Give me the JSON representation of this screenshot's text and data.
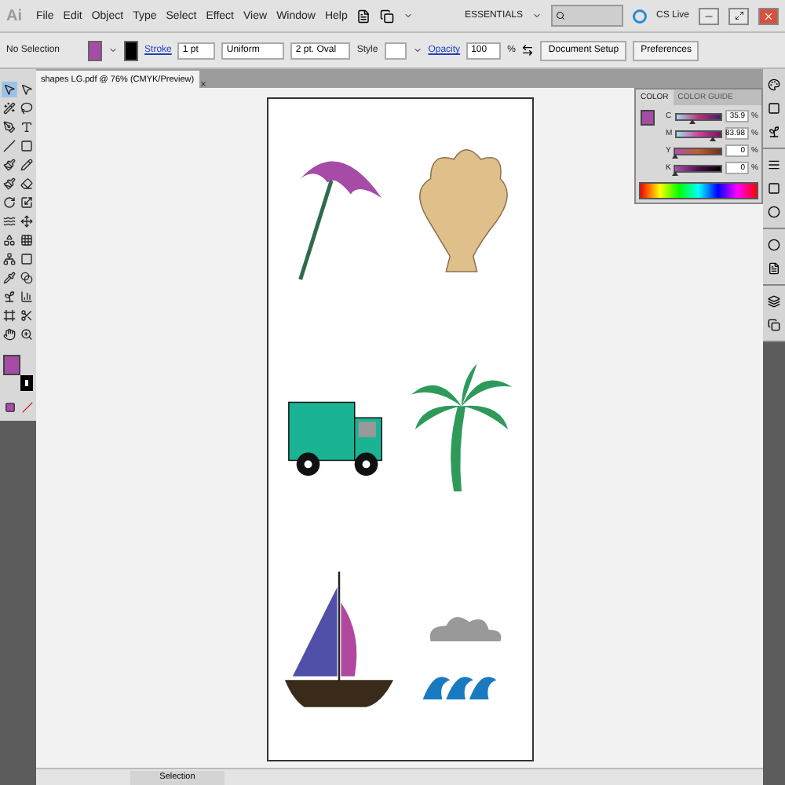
{
  "app": {
    "logo": "Ai",
    "menu": [
      "File",
      "Edit",
      "Object",
      "Type",
      "Select",
      "Effect",
      "View",
      "Window",
      "Help"
    ],
    "workspace": "ESSENTIALS",
    "cs_live": "CS Live"
  },
  "control_bar": {
    "selection": "No Selection",
    "stroke_label": "Stroke",
    "stroke_weight": "1 pt",
    "profile": "Uniform",
    "brush": "2 pt. Oval",
    "style_label": "Style",
    "opacity_label": "Opacity",
    "opacity": "100",
    "percent": "%",
    "buttons": [
      "Document Setup",
      "Preferences"
    ]
  },
  "document": {
    "tab": "shapes LG.pdf @ 76% (CMYK/Preview)",
    "artwork": [
      {
        "kind": "umbrella"
      },
      {
        "kind": "shell"
      },
      {
        "kind": "truck"
      },
      {
        "kind": "palm"
      },
      {
        "kind": "sailboat"
      },
      {
        "kind": "cloud-waves"
      }
    ]
  },
  "tools": [
    {
      "kind": "select",
      "selected": true
    },
    {
      "kind": "direct",
      "selected": false
    },
    {
      "kind": "wand",
      "selected": false
    },
    {
      "kind": "lasso",
      "selected": false
    },
    {
      "kind": "pen",
      "selected": false
    },
    {
      "kind": "type",
      "selected": false
    },
    {
      "kind": "line",
      "selected": false
    },
    {
      "kind": "rect",
      "selected": false
    },
    {
      "kind": "brush",
      "selected": false
    },
    {
      "kind": "pencil",
      "selected": false
    },
    {
      "kind": "blob",
      "selected": false
    },
    {
      "kind": "eraser",
      "selected": false
    },
    {
      "kind": "rotate",
      "selected": false
    },
    {
      "kind": "scale",
      "selected": false
    },
    {
      "kind": "warp",
      "selected": false
    },
    {
      "kind": "transform",
      "selected": false
    },
    {
      "kind": "builder",
      "selected": false
    },
    {
      "kind": "perspective",
      "selected": false
    },
    {
      "kind": "mesh",
      "selected": false
    },
    {
      "kind": "gradient",
      "selected": false
    },
    {
      "kind": "eyedropper",
      "selected": false
    },
    {
      "kind": "blend",
      "selected": false
    },
    {
      "kind": "symbol",
      "selected": false
    },
    {
      "kind": "graph",
      "selected": false
    },
    {
      "kind": "artboard",
      "selected": false
    },
    {
      "kind": "slice",
      "selected": false
    },
    {
      "kind": "hand",
      "selected": false
    },
    {
      "kind": "zoom",
      "selected": false
    }
  ],
  "color_panel": {
    "tabs": [
      {
        "label": "COLOR",
        "selected": true
      },
      {
        "label": "COLOR GUIDE",
        "selected": false
      }
    ],
    "channels": [
      {
        "name": "C",
        "value": "35.9",
        "level": 0.36
      },
      {
        "name": "M",
        "value": "83.98",
        "level": 0.84
      },
      {
        "name": "Y",
        "value": "0",
        "level": 0
      },
      {
        "name": "K",
        "value": "0",
        "level": 0
      }
    ],
    "unit": "%"
  },
  "status_bar": {
    "tool": "Selection"
  }
}
